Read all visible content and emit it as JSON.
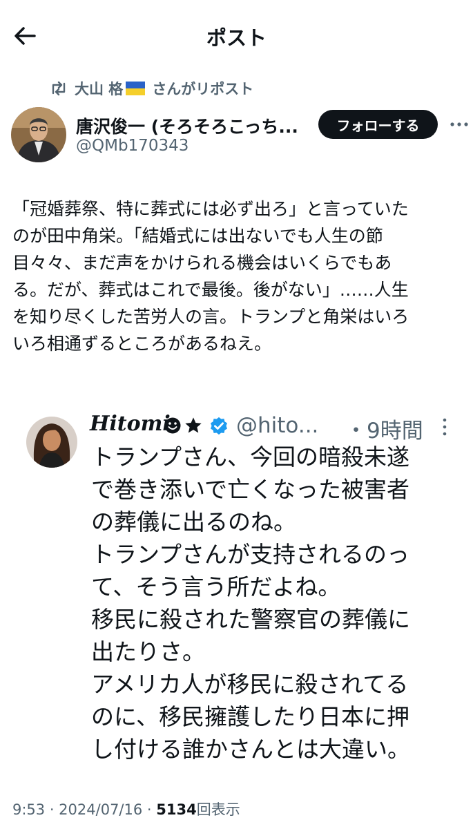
{
  "header": {
    "title": "ポスト",
    "back_icon": "arrow-left-icon"
  },
  "repost": {
    "prefix": "大山 格",
    "suffix": "さんがリポスト"
  },
  "author": {
    "name": "唐沢俊一 (そろそろこっち...",
    "handle": "@QMb170343"
  },
  "follow_label": "フォローする",
  "tweet_lines": [
    "「冠婚葬祭、特に葬式には必ず出ろ」と言っていた",
    "のが田中角栄。「結婚式には出ないでも人生の節",
    "目々々、まだ声をかけられる機会はいくらでもあ",
    "る。だが、葬式はこれで最後。後がない」……人生",
    "を知り尽くした苦労人の言。トランプと角栄はいろ",
    "いろ相通ずるところがあるねえ。"
  ],
  "embedded": {
    "name": "Hitomi",
    "handle": "@hito...",
    "time": "・9時間",
    "lines": [
      "トランプさん、今回の暗殺未遂",
      "で巻き添いで亡くなった被害者",
      "の葬儀に出るのね。",
      "トランプさんが支持されるのっ",
      "て、そう言う所だよね。",
      "移民に殺された警察官の葬儀に",
      "出たりさ。",
      "アメリカ人が移民に殺されてる",
      "のに、移民擁護したり日本に押",
      "し付ける誰かさんとは大違い。"
    ]
  },
  "meta": {
    "time": "9:53 · 2024/07/16 · ",
    "views": "5134",
    "views_label": "回表示"
  },
  "colors": {
    "text": "#0f1419",
    "secondary": "#536471",
    "verified": "#1d9bf0",
    "follow_bg": "#0f1419"
  }
}
